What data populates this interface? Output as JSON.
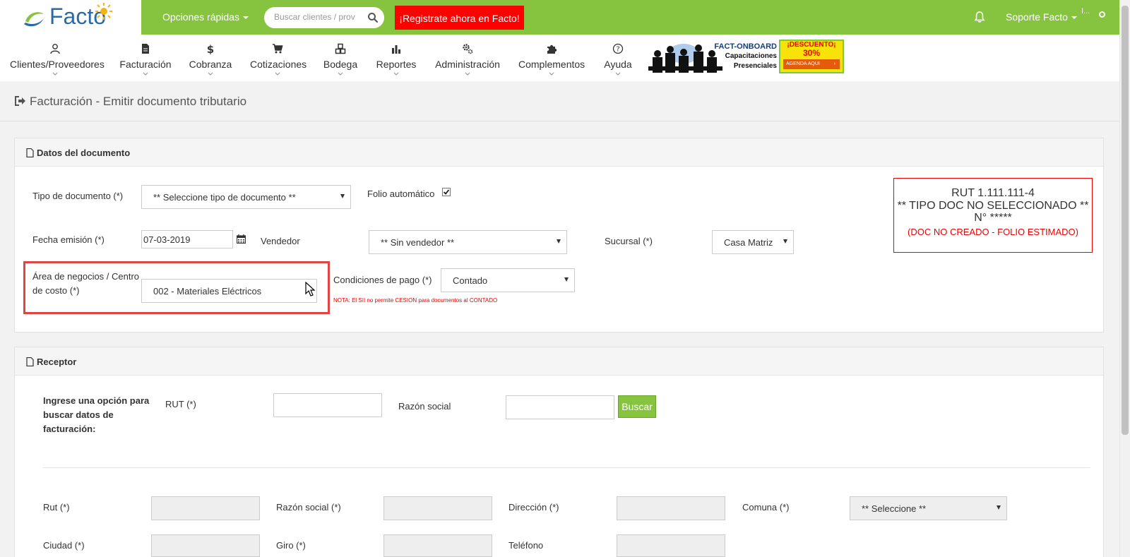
{
  "topbar": {
    "logo_text": "Facto",
    "quick_options": "Opciones rápidas",
    "search_placeholder": "Buscar clientes / prov",
    "register_label": "¡Registrate ahora en Facto!",
    "user_name": "Soporte Facto",
    "avatar_alt": "I..."
  },
  "nav": {
    "items": [
      {
        "label": "Clientes/Proveedores",
        "icon": "user-icon"
      },
      {
        "label": "Facturación",
        "icon": "file-icon"
      },
      {
        "label": "Cobranza",
        "icon": "dollar-icon"
      },
      {
        "label": "Cotizaciones",
        "icon": "cart-icon"
      },
      {
        "label": "Bodega",
        "icon": "cubes-icon"
      },
      {
        "label": "Reportes",
        "icon": "bar-chart-icon"
      },
      {
        "label": "Administración",
        "icon": "gears-icon"
      },
      {
        "label": "Complementos",
        "icon": "puzzle-icon"
      },
      {
        "label": "Ayuda",
        "icon": "help-icon"
      }
    ]
  },
  "banner": {
    "title": "FACT-ONBOARD",
    "line2": "Capacitaciones",
    "line3": "Presenciales",
    "discount": "¡DESCUENTO¡",
    "percent": "30%",
    "cta": "AGENDA AQUI"
  },
  "page": {
    "title": "Facturación - Emitir documento tributario"
  },
  "documento": {
    "heading": "Datos del documento",
    "tipo_label": "Tipo de documento (*)",
    "tipo_value": "** Seleccione tipo de documento **",
    "folio_label": "Folio automático",
    "fecha_label": "Fecha emisión (*)",
    "fecha_value": "07-03-2019",
    "vendedor_label": "Vendedor",
    "vendedor_value": "** Sin vendedor **",
    "sucursal_label": "Sucursal (*)",
    "sucursal_value": "Casa Matriz",
    "area_label_1": "Área de negocios / Centro",
    "area_label_2": "de costo (*)",
    "area_value": "002 - Materiales Eléctricos",
    "condiciones_label": "Condiciones de pago (*)",
    "condiciones_value": "Contado",
    "note": "NOTA: El SII no permite CESION para documentos al CONTADO"
  },
  "rut_box": {
    "line1": "RUT 1.111.111-4",
    "line2": "** TIPO DOC NO SELECCIONADO **",
    "line3": "N° *****",
    "line4": "(DOC NO CREADO - FOLIO ESTIMADO)"
  },
  "receptor": {
    "heading": "Receptor",
    "intro_1": "Ingrese una opción para",
    "intro_2": "buscar datos de",
    "intro_3": "facturación:",
    "rut_label": "RUT (*)",
    "razon_label": "Razón social",
    "buscar_label": "Buscar",
    "f_rut": "Rut (*)",
    "f_razon": "Razón social (*)",
    "f_direccion": "Dirección (*)",
    "f_comuna": "Comuna (*)",
    "comuna_value": "** Seleccione **",
    "f_ciudad": "Ciudad (*)",
    "f_giro": "Giro (*)",
    "f_telefono": "Teléfono"
  },
  "colors": {
    "brand_green": "#86c440",
    "alert_red": "#ff0000"
  }
}
